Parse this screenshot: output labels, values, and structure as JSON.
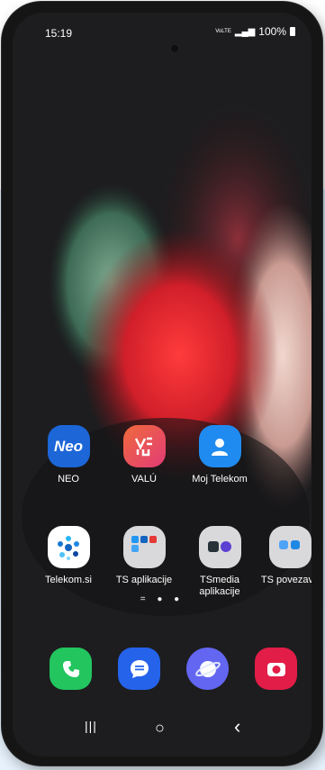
{
  "status_bar": {
    "time": "15:19",
    "network_label": "VoLTE",
    "battery": "100%"
  },
  "home_apps": [
    {
      "label": "NEO",
      "icon": "neo-icon",
      "color": "#1c66d8"
    },
    {
      "label": "VALÚ",
      "icon": "valu-icon",
      "color": "#e23b76"
    },
    {
      "label": "Moj Telekom",
      "icon": "moj-telekom-icon",
      "color": "#1f8bf0"
    },
    {
      "label": "Telekom.si",
      "icon": "telekom-si-icon",
      "color": "#ffffff"
    },
    {
      "label": "TS aplikacije",
      "icon": "folder-icon",
      "color": "#d9d9dc"
    },
    {
      "label": "TSmedia\naplikacije",
      "icon": "folder-icon",
      "color": "#d9d9dc"
    },
    {
      "label": "TS povezave",
      "icon": "folder-icon",
      "color": "#d9d9dc"
    }
  ],
  "neo_logo_text": "Neo",
  "page_indicator": "= ● ●",
  "dock": [
    {
      "icon": "phone-icon",
      "color": "#22c55e"
    },
    {
      "icon": "messages-icon",
      "color": "#2563eb"
    },
    {
      "icon": "internet-icon",
      "color": "#6366f1"
    },
    {
      "icon": "camera-icon",
      "color": "#e11d48"
    }
  ],
  "nav_bar": {
    "recents": "|||",
    "home": "○",
    "back": "‹"
  }
}
